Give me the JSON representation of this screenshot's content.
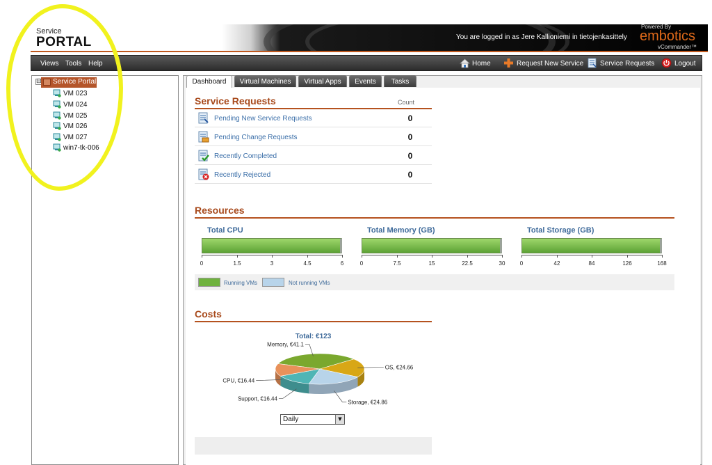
{
  "header": {
    "logo_small": "Service",
    "logo_big": "PORTAL",
    "login_text": "You are logged in as Jere Kallioniemi in tietojenkasittely",
    "powered_by": "Powered By",
    "brand": "embotics",
    "product": "vCommander™"
  },
  "menu": {
    "items": [
      {
        "label": "Views"
      },
      {
        "label": "Tools"
      },
      {
        "label": "Help"
      }
    ],
    "nav": [
      {
        "label": "Home",
        "icon": "home-icon"
      },
      {
        "label": "Request New Service",
        "icon": "plus-icon"
      },
      {
        "label": "Service Requests",
        "icon": "requests-icon"
      },
      {
        "label": "Logout",
        "icon": "logout-icon"
      }
    ]
  },
  "tree": {
    "toggle": "⊟",
    "root": "Service Portal",
    "items": [
      {
        "label": "VM 023"
      },
      {
        "label": "VM 024"
      },
      {
        "label": "VM 025"
      },
      {
        "label": "VM 026"
      },
      {
        "label": "VM 027"
      },
      {
        "label": "win7-tk-006"
      }
    ]
  },
  "tabs": [
    {
      "label": "Dashboard",
      "active": true
    },
    {
      "label": "Virtual Machines"
    },
    {
      "label": "Virtual Apps"
    },
    {
      "label": "Events"
    },
    {
      "label": "Tasks"
    }
  ],
  "service_requests": {
    "title": "Service Requests",
    "count_header": "Count",
    "rows": [
      {
        "label": "Pending New Service Requests",
        "count": "0"
      },
      {
        "label": "Pending Change Requests",
        "count": "0"
      },
      {
        "label": "Recently Completed",
        "count": "0"
      },
      {
        "label": "Recently Rejected",
        "count": "0"
      }
    ]
  },
  "resources": {
    "title": "Resources",
    "legend": {
      "running": "Running VMs",
      "not_running": "Not running VMs"
    }
  },
  "costs": {
    "title": "Costs",
    "select_value": "Daily"
  },
  "colors": {
    "accent": "#b5521f",
    "link": "#3a6ea8",
    "bar_green": "#6fb23e",
    "not_running": "#b8d4ea",
    "highlighter": "#f1f21e"
  },
  "chart_data": [
    {
      "type": "bar",
      "title": "Total CPU",
      "categories": [
        "Running VMs",
        "Not running VMs"
      ],
      "values": [
        6,
        0
      ],
      "xlim": [
        0,
        6
      ],
      "ticks": [
        "0",
        "1.5",
        "3",
        "4.5",
        "6"
      ]
    },
    {
      "type": "bar",
      "title": "Total Memory (GB)",
      "categories": [
        "Running VMs",
        "Not running VMs"
      ],
      "values": [
        30,
        0
      ],
      "xlim": [
        0,
        30
      ],
      "ticks": [
        "0",
        "7.5",
        "15",
        "22.5",
        "30"
      ]
    },
    {
      "type": "bar",
      "title": "Total Storage (GB)",
      "categories": [
        "Running VMs",
        "Not running VMs"
      ],
      "values": [
        168,
        0
      ],
      "xlim": [
        0,
        168
      ],
      "ticks": [
        "0",
        "42",
        "84",
        "126",
        "168"
      ]
    },
    {
      "type": "pie",
      "title": "Total: €123",
      "slices": [
        {
          "label": "Memory, €41.1",
          "value": 41.1,
          "color": "#7aa82e"
        },
        {
          "label": "OS, €24.66",
          "value": 24.66,
          "color": "#d8a716"
        },
        {
          "label": "Storage, €24.86",
          "value": 24.86,
          "color": "#b8d4ea"
        },
        {
          "label": "Support, €16.44",
          "value": 16.44,
          "color": "#4fb5b5"
        },
        {
          "label": "CPU, €16.44",
          "value": 16.44,
          "color": "#e8915a"
        }
      ]
    }
  ]
}
